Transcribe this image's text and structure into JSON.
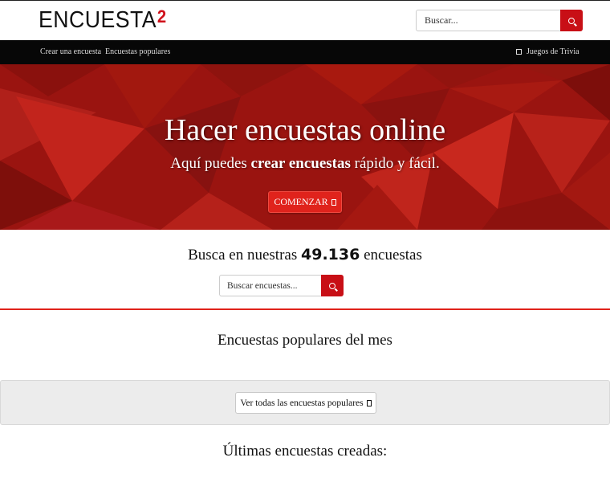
{
  "header": {
    "logo_text": "ENCUESTA",
    "logo_sup": "2",
    "search_placeholder": "Buscar...",
    "search_icon": "search-icon"
  },
  "nav": {
    "items": [
      {
        "label": "Crear una encuesta"
      },
      {
        "label": "Encuestas populares"
      },
      {
        "label": "Juegos de Trivia",
        "icon": "gamepad-icon"
      }
    ]
  },
  "hero": {
    "title": "Hacer encuestas online",
    "subtitle_pre": "Aquí puedes ",
    "subtitle_bold": "crear encuestas",
    "subtitle_post": " rápido y fácil.",
    "start_label": "COMENZAR",
    "start_icon": "arrow-icon",
    "colors": {
      "base": "#9a1410",
      "button": "#e0231c"
    }
  },
  "search_section": {
    "heading_pre": "Busca en nuestras ",
    "count": "49.136",
    "heading_post": " encuestas",
    "placeholder": "Buscar encuestas...",
    "search_icon": "search-icon"
  },
  "popular": {
    "title": "Encuestas populares del mes",
    "view_all_label": "Ver todas las encuestas populares"
  },
  "latest": {
    "title": "Últimas encuestas creadas:"
  },
  "colors": {
    "accent": "#c80f16",
    "nav_bg": "#070707"
  }
}
